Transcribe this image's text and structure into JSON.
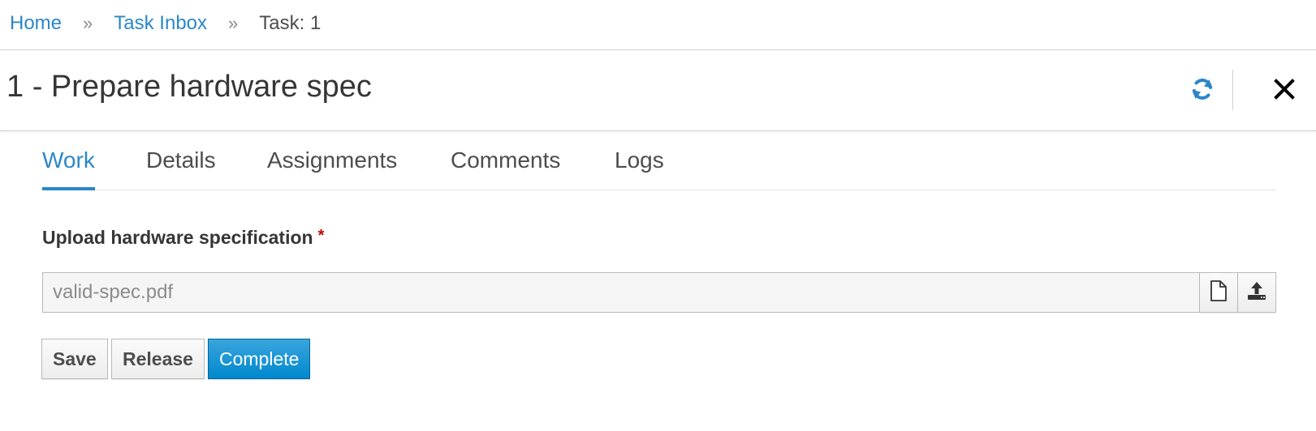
{
  "breadcrumb": {
    "items": [
      {
        "label": "Home",
        "link": true
      },
      {
        "label": "Task Inbox",
        "link": true
      },
      {
        "label": "Task: 1",
        "link": false
      }
    ],
    "separator": "»"
  },
  "header": {
    "title": "1 - Prepare hardware spec",
    "actions": [
      {
        "icon": "refresh-icon",
        "color": "#2b87c8"
      },
      {
        "icon": "close-icon",
        "color": "#000000"
      }
    ]
  },
  "tabs": [
    {
      "label": "Work",
      "active": true
    },
    {
      "label": "Details",
      "active": false
    },
    {
      "label": "Assignments",
      "active": false
    },
    {
      "label": "Comments",
      "active": false
    },
    {
      "label": "Logs",
      "active": false
    }
  ],
  "form": {
    "field_label": "Upload hardware specification",
    "required_marker": "*",
    "file_value": "valid-spec.pdf",
    "addons": [
      {
        "icon": "file-icon"
      },
      {
        "icon": "upload-icon"
      }
    ]
  },
  "buttons": {
    "save": "Save",
    "release": "Release",
    "complete": "Complete"
  },
  "colors": {
    "accent": "#2b87c8",
    "primary_button": "#0088ce",
    "required": "#c00000"
  }
}
